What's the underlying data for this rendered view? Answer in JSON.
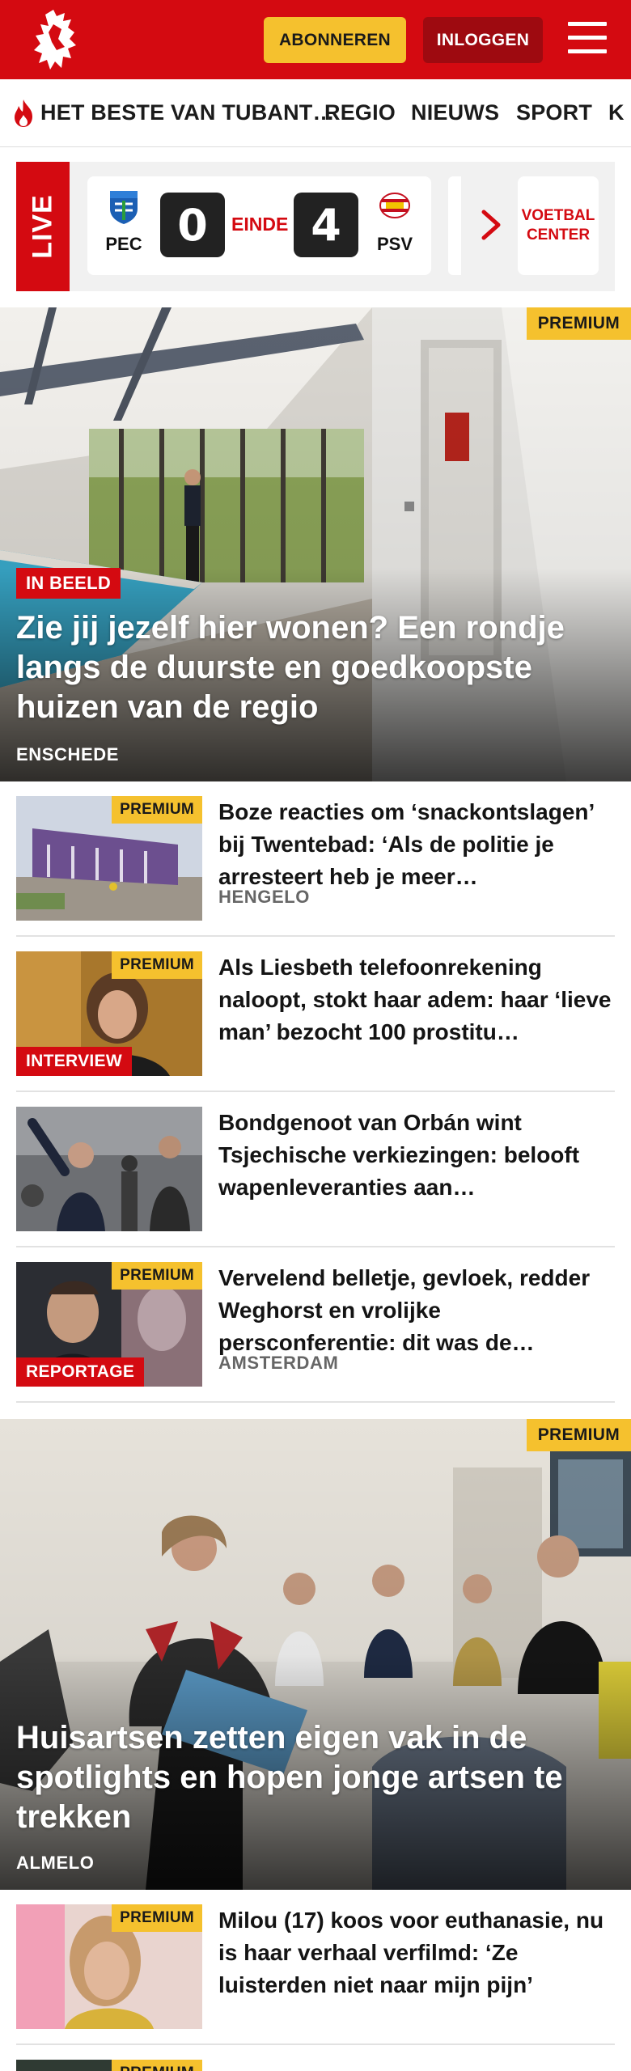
{
  "header": {
    "subscribe_label": "ABONNEREN",
    "login_label": "INLOGGEN",
    "logo_icon": "tubantia-horse-logo-icon",
    "menu_icon": "hamburger-menu-icon",
    "brand_color": "#d40a11",
    "accent_color": "#f5c12e"
  },
  "nav": {
    "items": [
      {
        "label": "HET BESTE VAN TUBANT…",
        "icon": "flame-icon"
      },
      {
        "label": "REGIO"
      },
      {
        "label": "NIEUWS"
      },
      {
        "label": "SPORT"
      },
      {
        "label": "K"
      }
    ]
  },
  "live": {
    "label": "LIVE",
    "match": {
      "home": "PEC",
      "home_score": "0",
      "status": "EINDE",
      "away_score": "4",
      "away": "PSV"
    },
    "voetbal_center": "VOETBAL CENTER"
  },
  "articles": {
    "hero1": {
      "premium": "PREMIUM",
      "tag": "IN BEELD",
      "title": "Zie jij jezelf hier wonen? Een rondje langs de duurste en goedkoopste huizen van de regio",
      "place": "ENSCHEDE"
    },
    "list1": [
      {
        "premium": "PREMIUM",
        "tag": "",
        "title": "Boze reacties om ‘snackontsla­gen’ bij Twentebad: ‘Als de politie je arresteert heb je meer…",
        "place": "HENGELO"
      },
      {
        "premium": "PREMIUM",
        "tag": "INTERVIEW",
        "title": "Als Liesbeth telefoonrekening naloopt, stokt haar adem: haar ‘lieve man’ bezocht 100 prostitu…",
        "place": ""
      },
      {
        "premium": "",
        "tag": "",
        "title": "Bondgenoot van Orbán wint Tsjechische verkiezingen: belooft wapenleveranties aan…",
        "place": ""
      },
      {
        "premium": "PREMIUM",
        "tag": "REPORTAGE",
        "title": "Vervelend belletje, gevloek, redder Weghorst en vrolijke persconferentie: dit was de…",
        "place": "AMSTERDAM"
      }
    ],
    "hero2": {
      "premium": "PREMIUM",
      "title": "Huisartsen zetten eigen vak in de spotlights en hopen jonge artsen te trekken",
      "place": "ALMELO"
    },
    "list2": [
      {
        "premium": "PREMIUM",
        "title": "Milou (17) koos voor euthanasie, nu is haar verhaal verfilmd: ‘Ze luisterden niet naar mijn pijn’",
        "place": ""
      },
      {
        "premium": "PREMIUM",
        "title": "",
        "place": ""
      }
    ]
  }
}
